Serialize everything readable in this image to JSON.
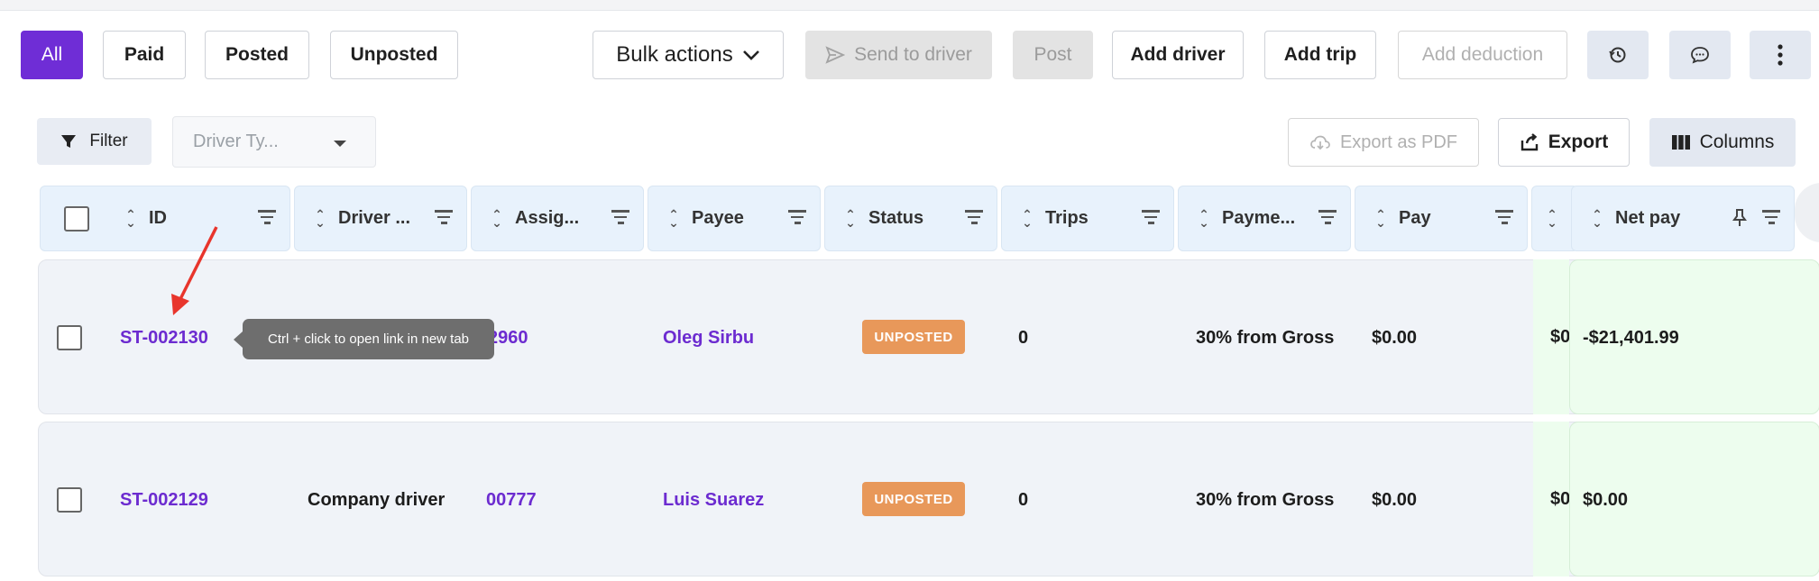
{
  "toolbar": {
    "all": "All",
    "paid": "Paid",
    "posted": "Posted",
    "unposted": "Unposted",
    "bulk_actions": "Bulk actions",
    "send_to_driver": "Send to driver",
    "post": "Post",
    "add_driver": "Add driver",
    "add_trip": "Add trip",
    "add_deduction": "Add deduction"
  },
  "filters": {
    "filter_label": "Filter",
    "driver_type_placeholder": "Driver Ty...",
    "export_pdf": "Export as PDF",
    "export": "Export",
    "columns": "Columns"
  },
  "table": {
    "headers": {
      "id": "ID",
      "driver": "Driver ...",
      "assigned": "Assig...",
      "payee": "Payee",
      "status": "Status",
      "trips": "Trips",
      "payment": "Payme...",
      "pay": "Pay",
      "net_pay": "Net pay"
    },
    "rows": [
      {
        "id": "ST-002130",
        "driver": "",
        "assigned": "2960",
        "payee": "Oleg Sirbu",
        "status": "UNPOSTED",
        "trips": "0",
        "payment": "30% from Gross",
        "pay": "$0.00",
        "partial": "$0",
        "net_pay": "-$21,401.99"
      },
      {
        "id": "ST-002129",
        "driver": "Company driver",
        "assigned": "00777",
        "payee": "Luis Suarez",
        "status": "UNPOSTED",
        "trips": "0",
        "payment": "30% from Gross",
        "pay": "$0.00",
        "partial": "$0",
        "net_pay": "$0.00"
      }
    ]
  },
  "tooltip": "Ctrl + click to open link in new tab",
  "colors": {
    "accent": "#6f2dd6",
    "badge": "#e8985a",
    "header_bg": "#e8f2fc",
    "arrow": "#e8352c"
  }
}
